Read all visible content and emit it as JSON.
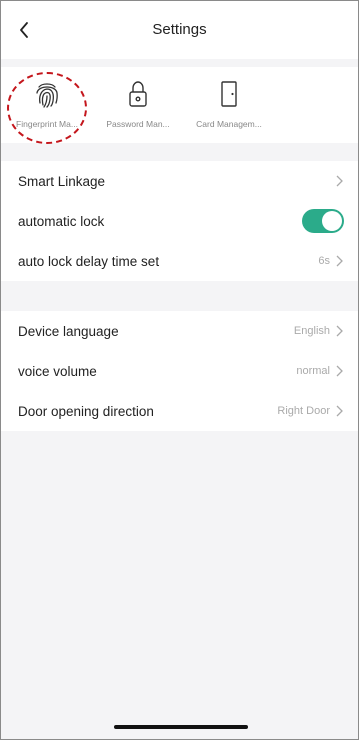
{
  "header": {
    "title": "Settings"
  },
  "quick_actions": [
    {
      "label": "Fingerprint Ma...",
      "icon": "fingerprint-icon"
    },
    {
      "label": "Password Man...",
      "icon": "padlock-icon"
    },
    {
      "label": "Card Managem...",
      "icon": "door-card-icon"
    }
  ],
  "group1": {
    "smart_linkage": {
      "label": "Smart Linkage"
    },
    "automatic_lock": {
      "label": "automatic lock",
      "enabled": true
    },
    "auto_lock_delay": {
      "label": "auto lock delay time set",
      "value": "6s"
    }
  },
  "group2": {
    "device_language": {
      "label": "Device language",
      "value": "English"
    },
    "voice_volume": {
      "label": "voice volume",
      "value": "normal"
    },
    "door_direction": {
      "label": "Door opening direction",
      "value": "Right Door"
    }
  },
  "colors": {
    "accent": "#2bab8a",
    "highlight": "#c4161c"
  }
}
